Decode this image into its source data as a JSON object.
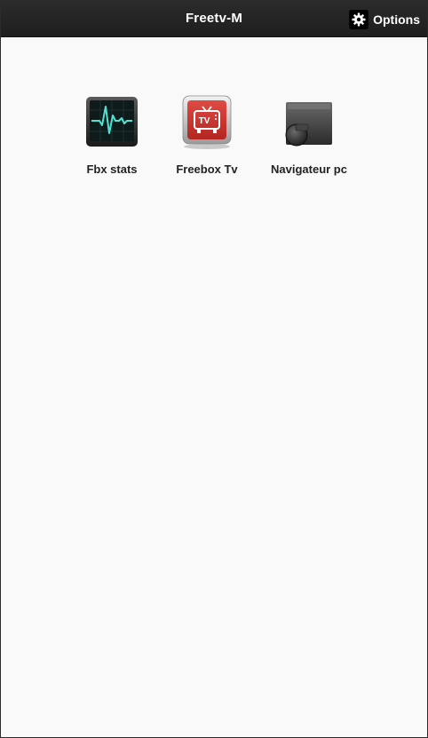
{
  "header": {
    "title": "Freetv-M",
    "options_label": "Options",
    "options_icon": "gear-icon"
  },
  "apps": [
    {
      "label": "Fbx stats",
      "icon": "activity-monitor-icon"
    },
    {
      "label": "Freebox Tv",
      "icon": "tv-icon"
    },
    {
      "label": "Navigateur pc",
      "icon": "drive-icon"
    }
  ],
  "colors": {
    "header_bg": "#232323",
    "content_bg": "#f9f9f9",
    "header_text": "#ffffff",
    "label_text": "#222222",
    "tv_red": "#c8312e",
    "pulse": "#4fe3d6"
  }
}
